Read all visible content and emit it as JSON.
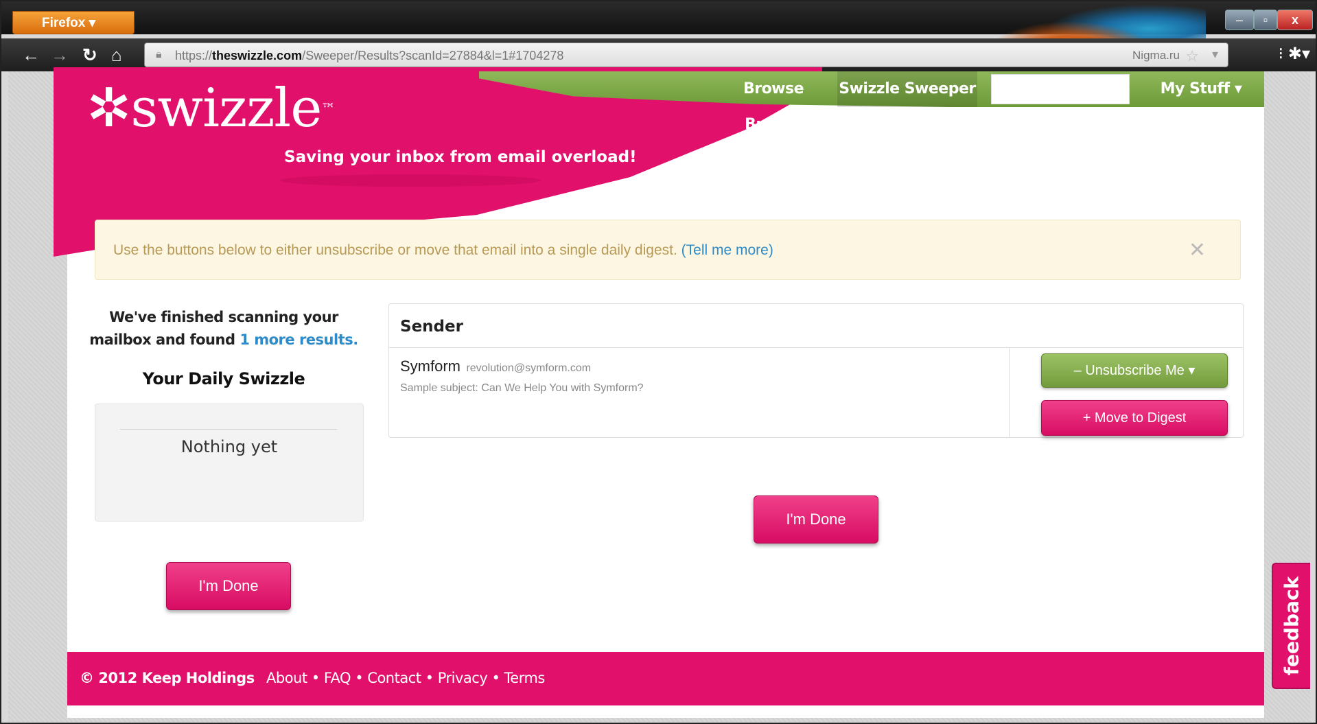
{
  "browser": {
    "menu_label": "Firefox ▾",
    "minimize_glyph": "–",
    "maximize_glyph": "▫",
    "close_glyph": "x",
    "url": {
      "scheme": "https://",
      "domain": "theswizzle.com",
      "path": "/Sweeper/Results?scanId=27884&l=1#1704278"
    },
    "search_engine": "Nigma.ru",
    "icons": [
      "back-icon",
      "forward-icon",
      "reload-icon",
      "home-icon",
      "lock-icon",
      "bookmark-star-icon",
      "addon-icon"
    ]
  },
  "header": {
    "logo_text": "✲swizzle",
    "logo_tm": "™",
    "tagline": "Saving your inbox from email overload!",
    "nav": {
      "browse_brands": "Browse Brands",
      "swizzle_sweeper": "Swizzle Sweeper",
      "my_stuff": "My Stuff ▾"
    }
  },
  "alert": {
    "text": "Use the buttons below to either unsubscribe or move that email into a single daily digest.",
    "link": "(Tell me more)",
    "close": "✕"
  },
  "sidebar": {
    "scan_text_line1": "We've finished scanning your",
    "scan_text_line2": "mailbox and found",
    "results_link": "1 more results.",
    "daily_title": "Your Daily Swizzle",
    "daily_empty": "Nothing yet",
    "done_button": "I'm Done"
  },
  "results": {
    "column_header": "Sender",
    "rows": [
      {
        "sender_name": "Symform",
        "sender_email": "revolution@symform.com",
        "sample_subject": "Sample subject: Can We Help You with Symform?",
        "unsubscribe_label": "– Unsubscribe Me ▾",
        "digest_label": "+ Move to Digest"
      }
    ],
    "done_button": "I'm Done"
  },
  "feedback_tab": "feedback",
  "footer": {
    "copyright": "© 2012 Keep Holdings",
    "links": [
      "About",
      "FAQ",
      "Contact",
      "Privacy",
      "Terms"
    ],
    "separator": " • "
  },
  "colors": {
    "brand_pink": "#e0106b",
    "brand_green": "#7ea848",
    "link_blue": "#2d8bc9",
    "alert_bg": "#fcf6e3"
  }
}
